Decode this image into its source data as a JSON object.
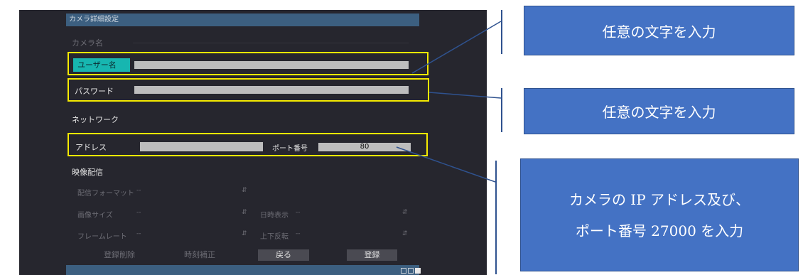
{
  "dialog": {
    "title": "カメラ詳細設定",
    "camera_name_label": "カメラ名",
    "username_label": "ユーザー名",
    "password_label": "パスワード",
    "network_section": "ネットワーク",
    "address_label": "アドレス",
    "port_label": "ポート番号",
    "port_value": "80",
    "video_section": "映像配信",
    "format_label": "配信フォーマット",
    "format_value": "--",
    "image_size_label": "画像サイズ",
    "image_size_value": "--",
    "framerate_label": "フレームレート",
    "framerate_value": "--",
    "datetime_label": "日時表示",
    "datetime_value": "--",
    "flip_label": "上下反転",
    "flip_value": "--",
    "buttons": {
      "delete": "登録削除",
      "time_sync": "時刻補正",
      "back": "戻る",
      "register": "登録"
    }
  },
  "callouts": {
    "c1": "任意の文字を入力",
    "c2": "任意の文字を入力",
    "c3_line1": "カメラの IP アドレス及び、",
    "c3_line2": "ポート番号 27000 を入力"
  },
  "colors": {
    "panel_bg": "#26262e",
    "title_bar": "#3c5f80",
    "highlight": "#f5ea00",
    "teal_label": "#17b6b0",
    "callout_fill": "#4472c4",
    "connector": "#2f528f"
  }
}
